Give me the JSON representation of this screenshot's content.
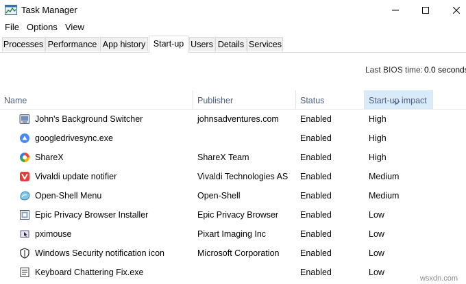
{
  "window": {
    "title": "Task Manager",
    "app_icon": "task-manager-icon",
    "controls": [
      "minimize-icon",
      "maximize-icon",
      "close-icon"
    ]
  },
  "menu": [
    "File",
    "Options",
    "View"
  ],
  "tabs": [
    "Processes",
    "Performance",
    "App history",
    "Start-up",
    "Users",
    "Details",
    "Services"
  ],
  "active_tab": "Start-up",
  "bios": {
    "label": "Last BIOS time:",
    "value": "0.0 seconds"
  },
  "columns": {
    "name": "Name",
    "publisher": "Publisher",
    "status": "Status",
    "impact": "Start-up impact",
    "sorted_column": "Start-up impact"
  },
  "rows": [
    {
      "name": "John's Background Switcher",
      "publisher": "johnsadventures.com",
      "status": "Enabled",
      "impact": "High",
      "icon": "johns-background-switcher-icon"
    },
    {
      "name": "googledrivesync.exe",
      "publisher": "",
      "status": "Enabled",
      "impact": "High",
      "icon": "google-drive-icon"
    },
    {
      "name": "ShareX",
      "publisher": "ShareX Team",
      "status": "Enabled",
      "impact": "High",
      "icon": "sharex-icon"
    },
    {
      "name": "Vivaldi update notifier",
      "publisher": "Vivaldi Technologies AS",
      "status": "Enabled",
      "impact": "Medium",
      "icon": "vivaldi-icon"
    },
    {
      "name": "Open-Shell Menu",
      "publisher": "Open-Shell",
      "status": "Enabled",
      "impact": "Medium",
      "icon": "open-shell-icon"
    },
    {
      "name": "Epic Privacy Browser Installer",
      "publisher": "Epic Privacy Browser",
      "status": "Enabled",
      "impact": "Low",
      "icon": "epic-browser-icon"
    },
    {
      "name": "pximouse",
      "publisher": "Pixart Imaging Inc",
      "status": "Enabled",
      "impact": "Low",
      "icon": "pximouse-icon"
    },
    {
      "name": "Windows Security notification icon",
      "publisher": "Microsoft Corporation",
      "status": "Enabled",
      "impact": "Low",
      "icon": "windows-security-shield-icon"
    },
    {
      "name": "Keyboard Chattering Fix.exe",
      "publisher": "",
      "status": "Enabled",
      "impact": "Low",
      "icon": "keyboard-fix-icon"
    }
  ],
  "colors": {
    "header_text": "#4d6082",
    "sorted_header_bg": "#d9ebf9",
    "tab_bg": "#f0f0f0",
    "border": "#d9d9d9"
  },
  "watermark": "wsxdn.com"
}
